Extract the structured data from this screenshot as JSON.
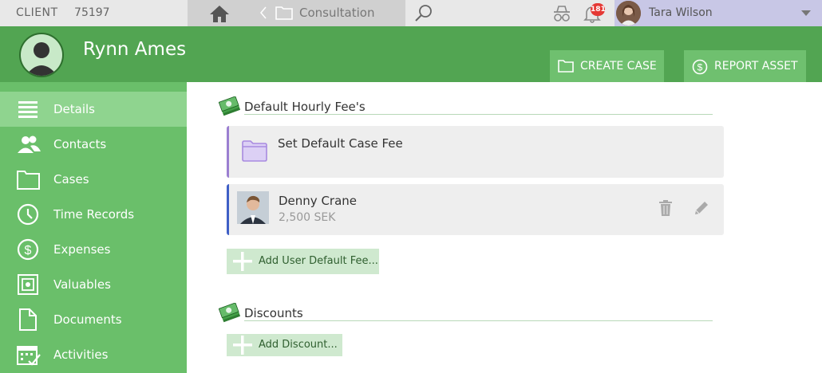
{
  "topbar": {
    "client_label": "CLIENT",
    "client_number": "75197",
    "breadcrumb": "Consultation",
    "notification_count": "181",
    "user_name": "Tara Wilson"
  },
  "header": {
    "title": "Rynn Ames",
    "create_case": "CREATE CASE",
    "report_asset": "REPORT ASSET"
  },
  "sidebar": {
    "items": [
      {
        "label": "Details",
        "icon": "list-icon"
      },
      {
        "label": "Contacts",
        "icon": "people-icon"
      },
      {
        "label": "Cases",
        "icon": "folder-icon"
      },
      {
        "label": "Time Records",
        "icon": "clock-icon"
      },
      {
        "label": "Expenses",
        "icon": "dollar-icon"
      },
      {
        "label": "Valuables",
        "icon": "safe-icon"
      },
      {
        "label": "Documents",
        "icon": "document-icon"
      },
      {
        "label": "Activities",
        "icon": "calendar-icon"
      }
    ]
  },
  "main": {
    "fees_title": "Default Hourly Fee's",
    "set_default_case_fee": "Set Default Case Fee",
    "fee_user_name": "Denny Crane",
    "fee_amount": "2,500 SEK",
    "add_user_fee": "Add User Default Fee...",
    "discounts_title": "Discounts",
    "add_discount": "Add Discount..."
  },
  "colors": {
    "accent_green": "#52a552",
    "sidebar_green": "#6abf6a",
    "active_item": "#8fd48f",
    "purple_border": "#9b7fd1",
    "blue_border": "#3f5fc6"
  }
}
